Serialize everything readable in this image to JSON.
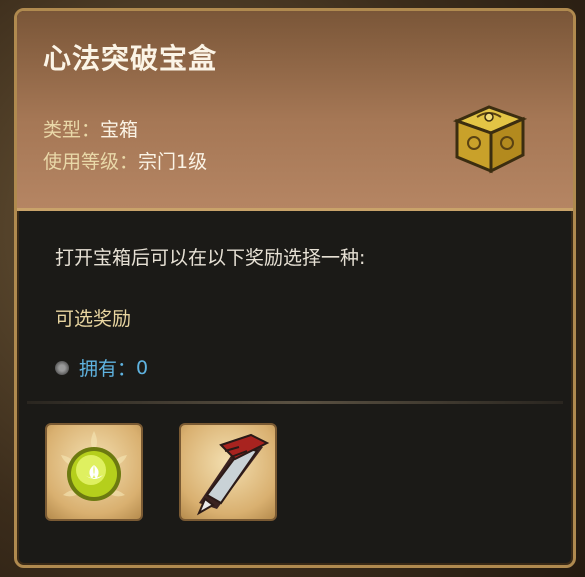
{
  "item": {
    "title": "心法突破宝盒",
    "type_label": "类型：",
    "type_value": "宝箱",
    "level_label": "使用等级：",
    "level_value": "宗门1级",
    "icon": "gold-chest-icon"
  },
  "description": "打开宝箱后可以在以下奖励选择一种:",
  "rewards_section": {
    "title": "可选奖励",
    "owned_label": "拥有：",
    "owned_value": "0",
    "owned_icon": "coin-icon"
  },
  "rewards": [
    {
      "icon": "glowing-orb-icon"
    },
    {
      "icon": "blade-talisman-icon"
    }
  ],
  "colors": {
    "border": "#b08a4f",
    "header_bg": "#a57755",
    "panel_bg": "#1b1a17",
    "owned_text": "#5fb3e0",
    "label_text": "#e8d5a0"
  }
}
